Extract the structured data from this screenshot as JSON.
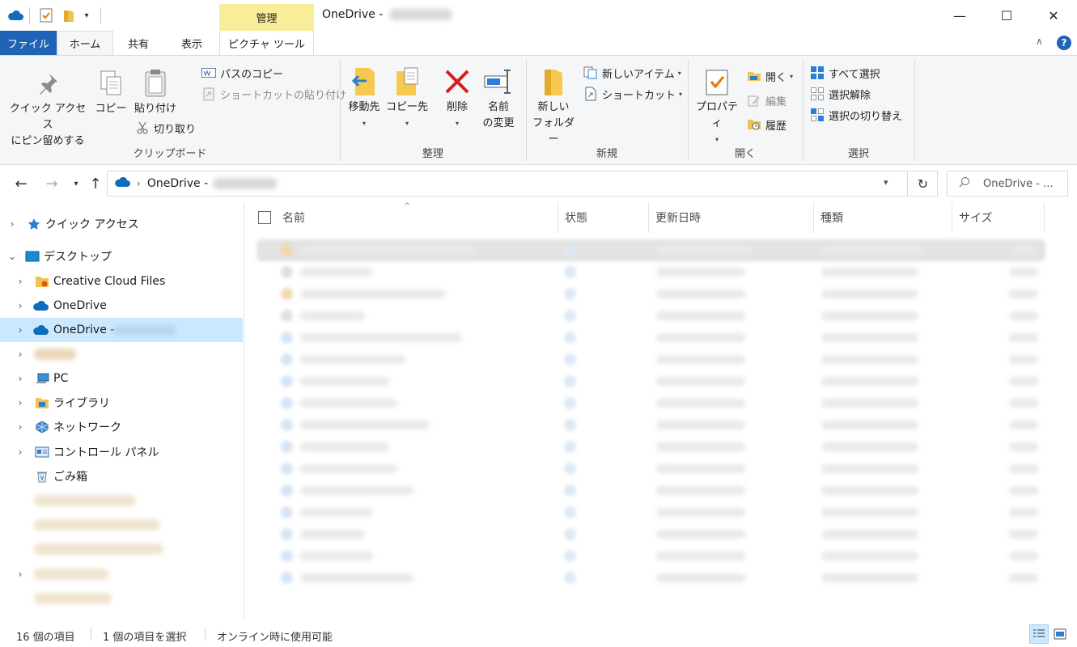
{
  "window": {
    "title": "OneDrive -",
    "context_tab_group": "管理",
    "controls": {
      "minimize": "—",
      "maximize": "☐",
      "close": "✕"
    }
  },
  "ribbon_tabs": {
    "file": "ファイル",
    "home": "ホーム",
    "share": "共有",
    "view": "表示",
    "picture_tools": "ピクチャ ツール"
  },
  "ribbon": {
    "clipboard": {
      "label": "クリップボード",
      "pin_quick_access_1": "クイック アクセス",
      "pin_quick_access_2": "にピン留めする",
      "copy": "コピー",
      "paste": "貼り付け",
      "copy_path": "パスのコピー",
      "paste_shortcut": "ショートカットの貼り付け",
      "cut": "切り取り"
    },
    "organize": {
      "label": "整理",
      "move_to": "移動先",
      "copy_to": "コピー先",
      "delete": "削除",
      "rename_1": "名前",
      "rename_2": "の変更"
    },
    "new": {
      "label": "新規",
      "new_folder_1": "新しい",
      "new_folder_2": "フォルダー",
      "new_item": "新しいアイテム",
      "shortcut": "ショートカット"
    },
    "open": {
      "label": "開く",
      "properties": "プロパティ",
      "open": "開く",
      "edit": "編集",
      "history": "履歴"
    },
    "select": {
      "label": "選択",
      "select_all": "すべて選択",
      "select_none": "選択解除",
      "invert": "選択の切り替え"
    }
  },
  "address_bar": {
    "path_root": "OneDrive -",
    "search_placeholder": "OneDrive - ..."
  },
  "nav_pane": {
    "items": [
      {
        "label": "クイック アクセス"
      },
      {
        "label": "デスクトップ"
      },
      {
        "label": "Creative Cloud Files"
      },
      {
        "label": "OneDrive"
      },
      {
        "label": "OneDrive -"
      },
      {
        "label": "PC"
      },
      {
        "label": "ライブラリ"
      },
      {
        "label": "ネットワーク"
      },
      {
        "label": "コントロール パネル"
      },
      {
        "label": "ごみ箱"
      }
    ]
  },
  "file_list": {
    "columns": {
      "name": "名前",
      "status": "状態",
      "modified": "更新日時",
      "type": "種類",
      "size": "サイズ"
    }
  },
  "status_bar": {
    "item_count": "16 個の項目",
    "selected": "1 個の項目を選択",
    "availability": "オンライン時に使用可能"
  },
  "colors": {
    "file_tab": "#1e63b6",
    "context_tab": "#f8ee9a",
    "selection": "#cce8ff",
    "ribbon_bg": "#f5f6f7"
  }
}
